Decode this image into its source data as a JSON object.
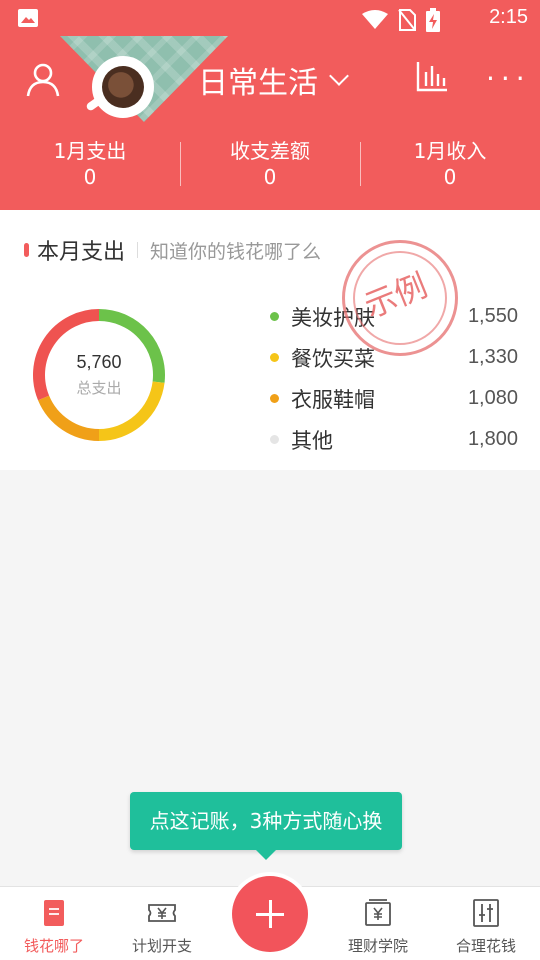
{
  "status_bar": {
    "time": "2:15"
  },
  "header": {
    "ledger_name": "日常生活"
  },
  "summary": [
    {
      "label": "1月支出",
      "value": "0"
    },
    {
      "label": "收支差额",
      "value": "0"
    },
    {
      "label": "1月收入",
      "value": "0"
    }
  ],
  "card": {
    "title": "本月支出",
    "subtitle": "知道你的钱花哪了么",
    "total": "5,760",
    "total_caption": "总支出",
    "stamp": "示例",
    "legend": [
      {
        "name": "美妆护肤",
        "amount": "1,550",
        "color": "#6cc24a"
      },
      {
        "name": "餐饮买菜",
        "amount": "1,330",
        "color": "#f5c518"
      },
      {
        "name": "衣服鞋帽",
        "amount": "1,080",
        "color": "#f0a018"
      },
      {
        "name": "其他",
        "amount": "1,800",
        "color": "#e5e5e5"
      }
    ]
  },
  "chart_data": {
    "type": "pie",
    "categories": [
      "美妆护肤",
      "餐饮买菜",
      "衣服鞋帽",
      "其他"
    ],
    "values": [
      1550,
      1330,
      1080,
      1800
    ],
    "colors": [
      "#6cc24a",
      "#f5c518",
      "#f0a018",
      "#ef5350"
    ]
  },
  "tooltip": "点这记账，3种方式随心换",
  "tabs": [
    {
      "label": "钱花哪了",
      "icon": "ledger-icon"
    },
    {
      "label": "计划开支",
      "icon": "ticket-yuan-icon"
    },
    {
      "label": "理财学院",
      "icon": "yuan-book-icon"
    },
    {
      "label": "合理花钱",
      "icon": "sliders-icon"
    }
  ],
  "colors": {
    "primary": "#f25c5c",
    "tooltip": "#1fbf9b"
  }
}
